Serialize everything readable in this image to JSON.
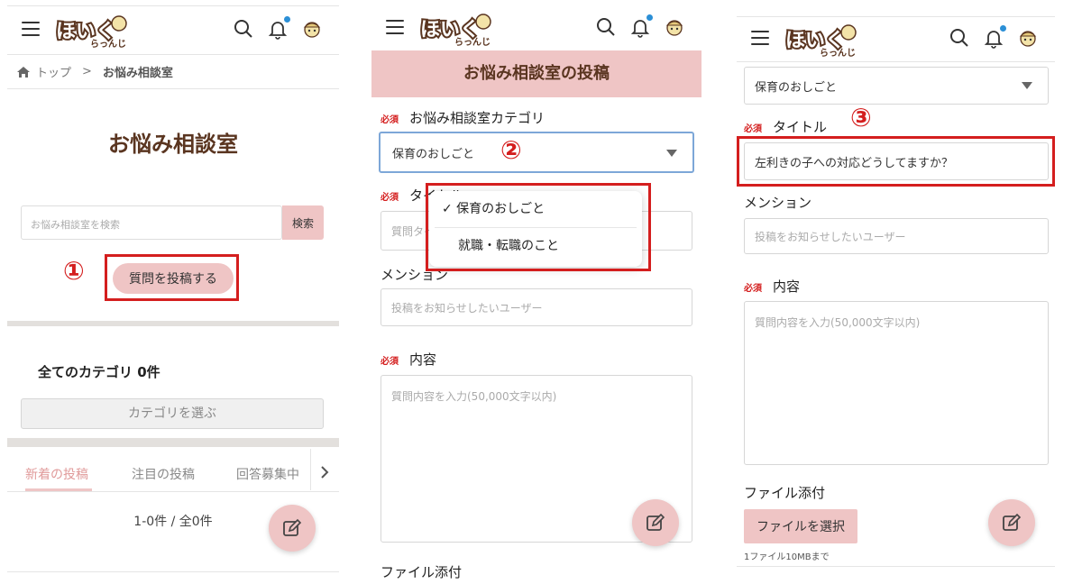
{
  "header": {
    "bell_dot_color": "#2b8fd6"
  },
  "panel1": {
    "breadcrumb": {
      "home": "トップ",
      "separator": ">",
      "current": "お悩み相談室"
    },
    "title": "お悩み相談室",
    "search": {
      "placeholder": "お悩み相談室を検索",
      "button": "検索"
    },
    "post_button": "質問を投稿する",
    "step": "①",
    "category_heading": "全てのカテゴリ 0件",
    "category_button": "カテゴリを選ぶ",
    "tabs": [
      "新着の投稿",
      "注目の投稿",
      "回答募集中"
    ],
    "count_text": "1-0件 / 全0件"
  },
  "panel2": {
    "header_title": "お悩み相談室の投稿",
    "required": "必須",
    "category_label": "お悩み相談室カテゴリ",
    "category_value": "保育のおしごと",
    "step": "②",
    "dropdown_options": [
      {
        "label": "✓ 保育のおしごと"
      },
      {
        "label": "就職・転職のこと"
      }
    ],
    "title_label": "タイトル",
    "title_placeholder": "質問タイトル",
    "mention_label": "メンション",
    "mention_placeholder": "投稿をお知らせしたいユーザー",
    "content_label": "内容",
    "content_placeholder": "質問内容を入力(50,000文字以内)",
    "file_label": "ファイル添付"
  },
  "panel3": {
    "category_value": "保育のおしごと",
    "required": "必須",
    "title_label": "タイトル",
    "title_value": "左利きの子への対応どうしてますか？",
    "step": "③",
    "mention_label": "メンション",
    "mention_placeholder": "投稿をお知らせしたいユーザー",
    "content_label": "内容",
    "content_placeholder": "質問内容を入力(50,000文字以内)",
    "file_label": "ファイル添付",
    "file_button": "ファイルを選択",
    "file_note": "1ファイル10MBまで"
  },
  "colors": {
    "accent_pink": "#efc5c5",
    "annotation_red": "#d41e1e",
    "title_brown": "#5a3520"
  }
}
